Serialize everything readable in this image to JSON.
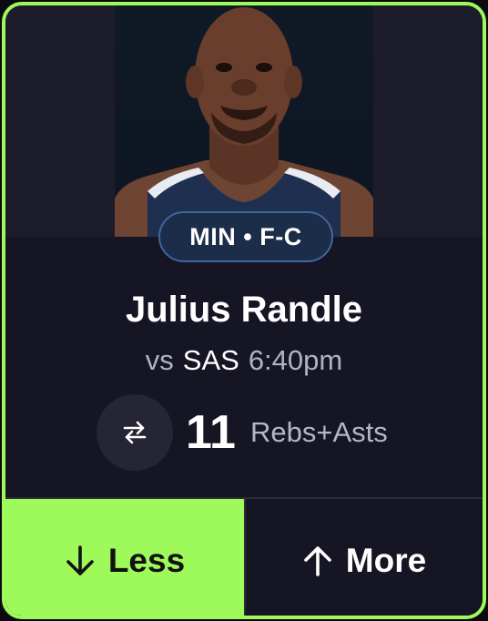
{
  "pick": {
    "team_position": "MIN • F-C",
    "player_name": "Julius Randle",
    "matchup_prefix": "vs",
    "opponent": "SAS",
    "game_time": "6:40pm",
    "line_value": "11",
    "stat_type": "Rebs+Asts"
  },
  "actions": {
    "less_label": "Less",
    "less_icon": "arrow-down-icon",
    "more_label": "More",
    "more_icon": "arrow-up-icon",
    "selected": "less"
  },
  "colors": {
    "accent": "#9efa5a",
    "card_background": "#1b1b29",
    "pill_background": "#1c2d4a",
    "pill_border": "#40669f"
  }
}
